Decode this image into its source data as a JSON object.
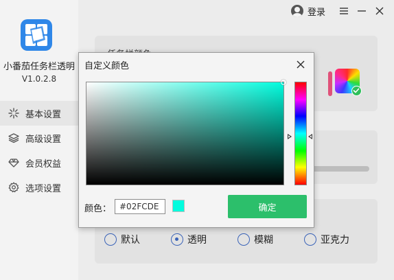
{
  "app": {
    "name": "小番茄任务栏透明",
    "version": "V1.0.2.8"
  },
  "topbar": {
    "login_label": "登录"
  },
  "nav": {
    "items": [
      {
        "label": "基本设置",
        "icon": "sparkle-icon",
        "active": true
      },
      {
        "label": "高级设置",
        "icon": "layers-icon",
        "active": false
      },
      {
        "label": "会员权益",
        "icon": "diamond-icon",
        "active": false
      },
      {
        "label": "选项设置",
        "icon": "gear-icon",
        "active": false
      }
    ]
  },
  "main": {
    "taskbar_color_title": "任务栏颜色",
    "style_options": [
      {
        "label": "默认",
        "checked": false
      },
      {
        "label": "透明",
        "checked": true
      },
      {
        "label": "模糊",
        "checked": false
      },
      {
        "label": "亚克力",
        "checked": false
      }
    ]
  },
  "dialog": {
    "title": "自定义颜色",
    "color_label": "颜色：",
    "hex_value": "#02FCDE",
    "selected_color": "#02FCDE",
    "confirm_label": "确定"
  },
  "colors": {
    "accent_green": "#2CBF6B",
    "brand_blue": "#2F87E8",
    "radio_blue": "#3A63B8"
  }
}
